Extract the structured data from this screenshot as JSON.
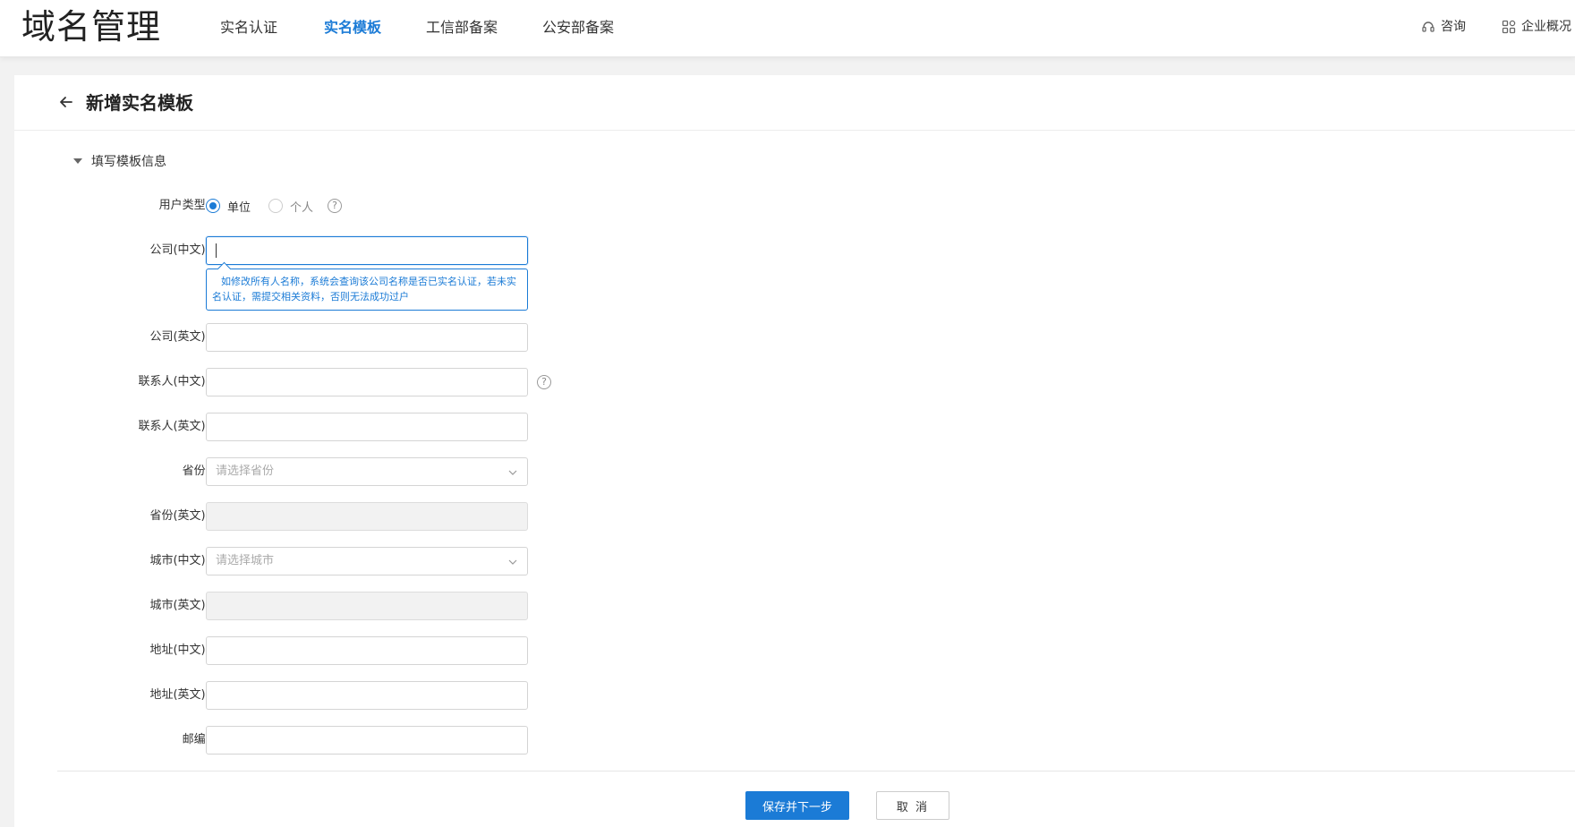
{
  "app": {
    "title": "域名管理"
  },
  "nav": {
    "items": [
      {
        "label": "实名认证",
        "active": false
      },
      {
        "label": "实名模板",
        "active": true
      },
      {
        "label": "工信部备案",
        "active": false
      },
      {
        "label": "公安部备案",
        "active": false
      }
    ],
    "consult_label": "咨询",
    "overview_label": "企业概况"
  },
  "page": {
    "title": "新增实名模板",
    "section_title": "填写模板信息"
  },
  "form": {
    "user_type": {
      "label": "用户类型:",
      "options": [
        "单位",
        "个人"
      ],
      "selected": "单位"
    },
    "company_cn": {
      "label": "公司(中文):",
      "value": ""
    },
    "company_cn_tip": "如修改所有人名称，系统会查询该公司名称是否已实名认证，若未实名认证，需提交相关资料，否则无法成功过户",
    "company_en": {
      "label": "公司(英文):",
      "value": ""
    },
    "contact_cn": {
      "label": "联系人(中文):",
      "value": ""
    },
    "contact_en": {
      "label": "联系人(英文):",
      "value": ""
    },
    "province": {
      "label": "省份:",
      "placeholder": "请选择省份"
    },
    "province_en": {
      "label": "省份(英文):",
      "value": ""
    },
    "city_cn": {
      "label": "城市(中文):",
      "placeholder": "请选择城市"
    },
    "city_en": {
      "label": "城市(英文):",
      "value": ""
    },
    "address_cn": {
      "label": "地址(中文):",
      "value": ""
    },
    "address_en": {
      "label": "地址(英文):",
      "value": ""
    },
    "postcode": {
      "label": "邮编:",
      "value": ""
    }
  },
  "actions": {
    "save_next": "保存并下一步",
    "cancel": "取 消"
  },
  "colors": {
    "accent": "#1b7bd6",
    "background": "#f2f2f2"
  }
}
